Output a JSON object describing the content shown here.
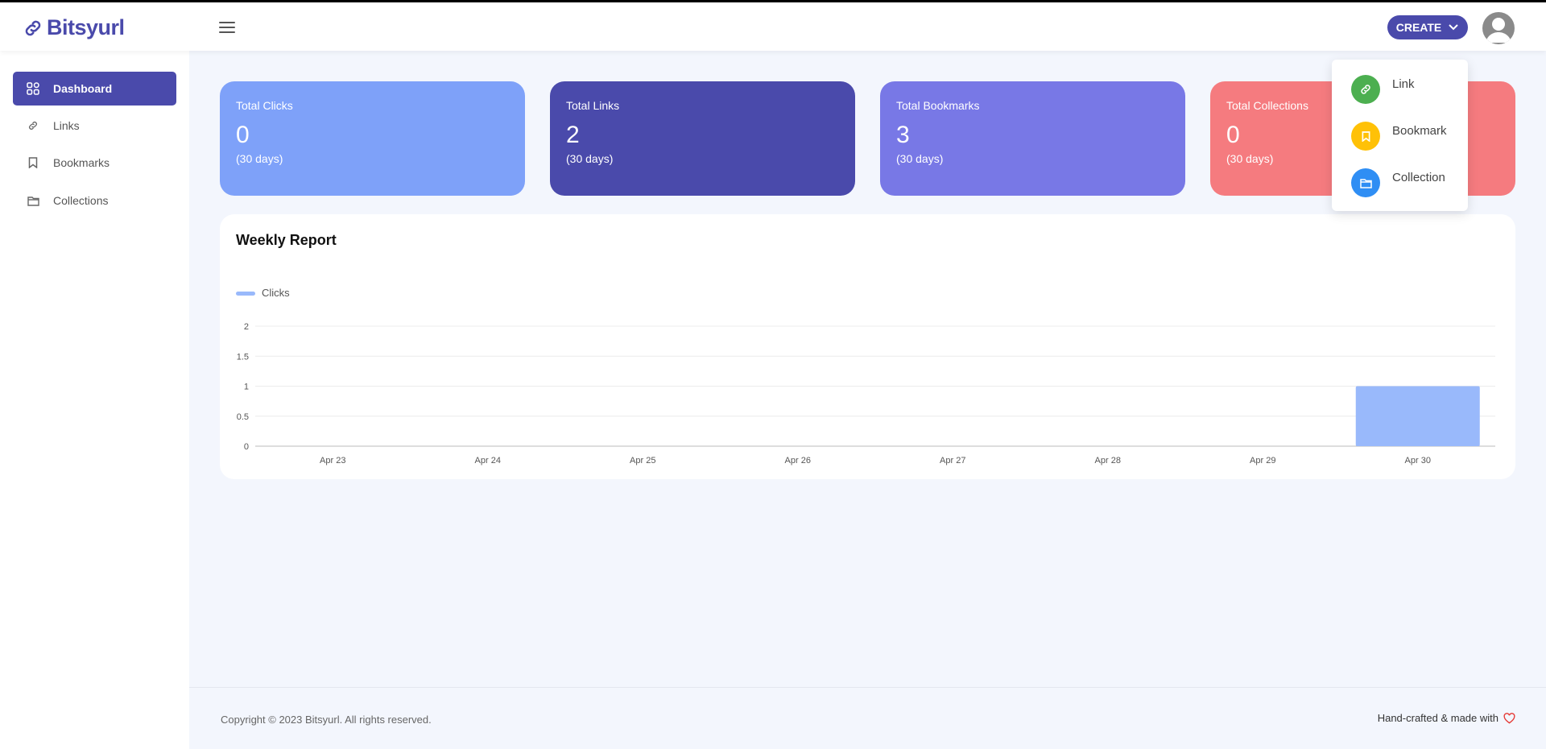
{
  "app": {
    "name": "Bitsyurl"
  },
  "header": {
    "create_label": "CREATE"
  },
  "sidebar": {
    "items": [
      {
        "label": "Dashboard",
        "icon": "grid-icon",
        "active": true
      },
      {
        "label": "Links",
        "icon": "link-icon"
      },
      {
        "label": "Bookmarks",
        "icon": "bookmark-icon"
      },
      {
        "label": "Collections",
        "icon": "folder-icon"
      }
    ]
  },
  "stats": [
    {
      "title": "Total Clicks",
      "value": "0",
      "period": "(30 days)",
      "color": "#7ea1f9"
    },
    {
      "title": "Total Links",
      "value": "2",
      "period": "(30 days)",
      "color": "#4a4aab"
    },
    {
      "title": "Total Bookmarks",
      "value": "3",
      "period": "(30 days)",
      "color": "#7878e6"
    },
    {
      "title": "Total Collections",
      "value": "0",
      "period": "(30 days)",
      "color": "#f57b7f"
    }
  ],
  "create_menu": {
    "items": [
      {
        "label": "Link",
        "icon": "link-icon",
        "color": "#4caf50"
      },
      {
        "label": "Bookmark",
        "icon": "bookmark-icon",
        "color": "#ffc107"
      },
      {
        "label": "Collection",
        "icon": "folder-icon",
        "color": "#2f8ef4"
      }
    ]
  },
  "report": {
    "title": "Weekly Report"
  },
  "chart_data": {
    "type": "bar",
    "categories": [
      "Apr 23",
      "Apr 24",
      "Apr 25",
      "Apr 26",
      "Apr 27",
      "Apr 28",
      "Apr 29",
      "Apr 30"
    ],
    "series": [
      {
        "name": "Clicks",
        "values": [
          0,
          0,
          0,
          0,
          0,
          0,
          0,
          1
        ],
        "color": "#99b9fb"
      }
    ],
    "ylim": [
      0,
      2
    ],
    "yticks": [
      "0",
      "0.5",
      "1",
      "1.5",
      "2"
    ],
    "legend": "top-left",
    "grid": true
  },
  "footer": {
    "copyright": "Copyright © 2023 Bitsyurl. All rights reserved.",
    "crafted": "Hand-crafted & made with"
  }
}
